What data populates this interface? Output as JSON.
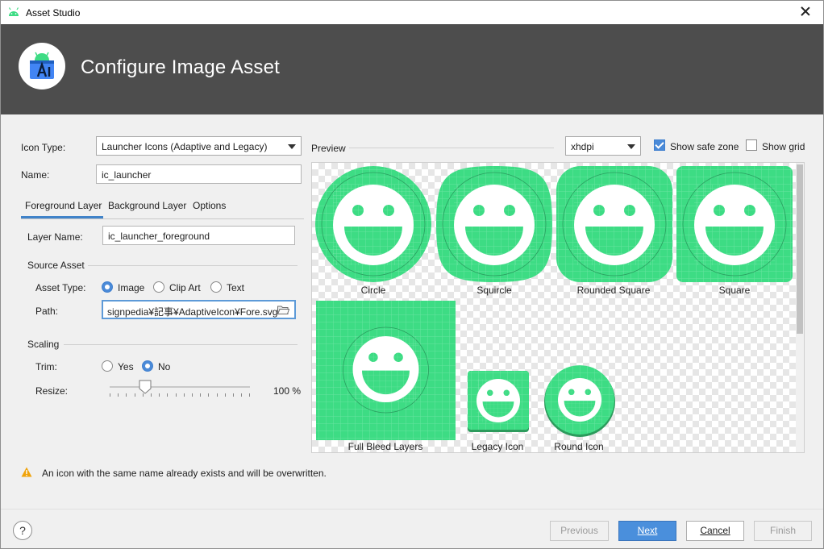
{
  "window": {
    "title": "Asset Studio"
  },
  "header": {
    "title": "Configure Image Asset"
  },
  "form": {
    "icon_type_label": "Icon Type:",
    "icon_type_value": "Launcher Icons (Adaptive and Legacy)",
    "name_label": "Name:",
    "name_value": "ic_launcher"
  },
  "tabs": [
    {
      "label": "Foreground Layer",
      "active": true
    },
    {
      "label": "Background Layer",
      "active": false
    },
    {
      "label": "Options",
      "active": false
    }
  ],
  "foreground": {
    "layer_name_label": "Layer Name:",
    "layer_name_value": "ic_launcher_foreground",
    "source_asset_title": "Source Asset",
    "asset_type_label": "Asset Type:",
    "asset_types": [
      {
        "label": "Image",
        "checked": true
      },
      {
        "label": "Clip Art",
        "checked": false
      },
      {
        "label": "Text",
        "checked": false
      }
    ],
    "path_label": "Path:",
    "path_value": "signpedia¥記事¥AdaptiveIcon¥Fore.svg",
    "scaling_title": "Scaling",
    "trim_label": "Trim:",
    "trim_options": [
      {
        "label": "Yes",
        "checked": false
      },
      {
        "label": "No",
        "checked": true
      }
    ],
    "resize_label": "Resize:",
    "resize_value": "100 %",
    "resize_fraction": 0.25
  },
  "preview": {
    "label": "Preview",
    "density_value": "xhdpi",
    "show_safe_zone_label": "Show safe zone",
    "show_safe_zone_checked": true,
    "show_grid_label": "Show grid",
    "show_grid_checked": false,
    "captions": {
      "circle": "Circle",
      "squircle": "Squircle",
      "rounded_square": "Rounded Square",
      "square": "Square",
      "full_bleed": "Full Bleed Layers",
      "legacy": "Legacy Icon",
      "round": "Round Icon"
    },
    "icon_color": "#3ddc84"
  },
  "warning": {
    "text": "An icon with the same name already exists and will be overwritten."
  },
  "buttons": {
    "help": "?",
    "previous": "Previous",
    "next": "Next",
    "cancel": "Cancel",
    "finish": "Finish"
  }
}
